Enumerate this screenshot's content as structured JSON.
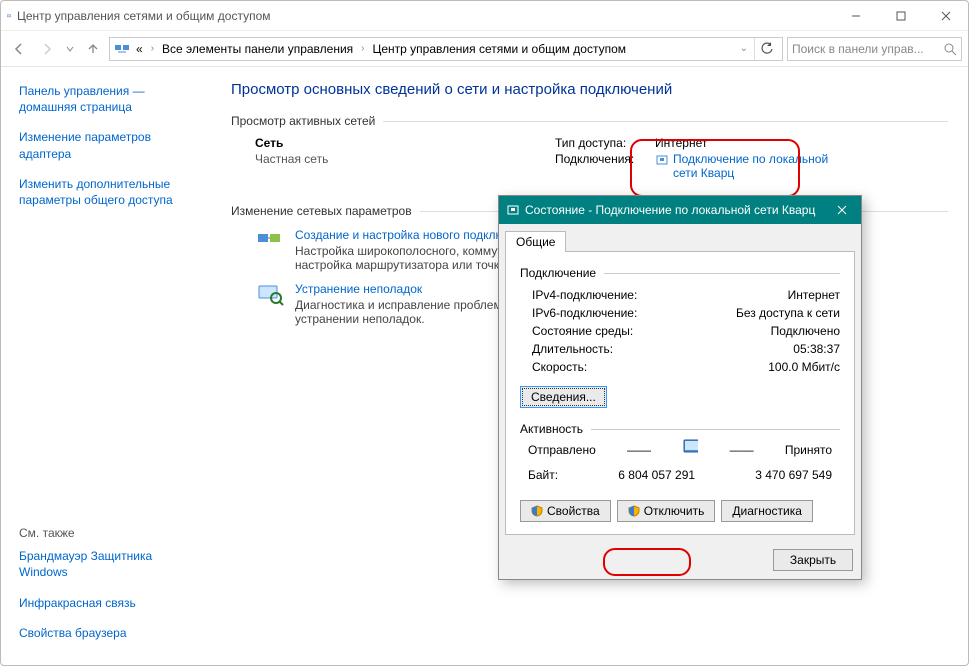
{
  "window": {
    "title": "Центр управления сетями и общим доступом"
  },
  "breadcrumb": {
    "root_symbol": "«",
    "items": [
      "Все элементы панели управления",
      "Центр управления сетями и общим доступом"
    ]
  },
  "search": {
    "placeholder": "Поиск в панели управ..."
  },
  "sidebar": {
    "home": "Панель управления — домашняя страница",
    "items": [
      "Изменение параметров адаптера",
      "Изменить дополнительные параметры общего доступа"
    ],
    "see_also_label": "См. также",
    "see_also": [
      "Брандмауэр Защитника Windows",
      "Инфракрасная связь",
      "Свойства браузера"
    ]
  },
  "main": {
    "title": "Просмотр основных сведений о сети и настройка подключений",
    "active_networks_label": "Просмотр активных сетей",
    "network": {
      "name": "Сеть",
      "type": "Частная сеть",
      "access_label": "Тип доступа:",
      "access_value": "Интернет",
      "conn_label": "Подключения:",
      "conn_value": "Подключение по локальной сети Кварц"
    },
    "change_settings_label": "Изменение сетевых параметров",
    "tasks": [
      {
        "title": "Создание и настройка нового подключения или сети",
        "desc": "Настройка широкополосного, коммутируемого или VPN-подключения либо настройка маршрутизатора или точки доступа."
      },
      {
        "title": "Устранение неполадок",
        "desc": "Диагностика и исправление проблем с сетью или получение сведений об устранении неполадок."
      }
    ]
  },
  "dialog": {
    "title": "Состояние - Подключение по локальной сети Кварц",
    "tab": "Общие",
    "connection_label": "Подключение",
    "rows": {
      "ipv4_k": "IPv4-подключение:",
      "ipv4_v": "Интернет",
      "ipv6_k": "IPv6-подключение:",
      "ipv6_v": "Без доступа к сети",
      "media_k": "Состояние среды:",
      "media_v": "Подключено",
      "dur_k": "Длительность:",
      "dur_v": "05:38:37",
      "speed_k": "Скорость:",
      "speed_v": "100.0 Мбит/с"
    },
    "details_btn": "Сведения...",
    "activity_label": "Активность",
    "sent_label": "Отправлено",
    "recv_label": "Принято",
    "bytes_label": "Байт:",
    "bytes_sent": "6 804 057 291",
    "bytes_recv": "3 470 697 549",
    "btn_props": "Свойства",
    "btn_disable": "Отключить",
    "btn_diag": "Диагностика",
    "btn_close": "Закрыть"
  }
}
